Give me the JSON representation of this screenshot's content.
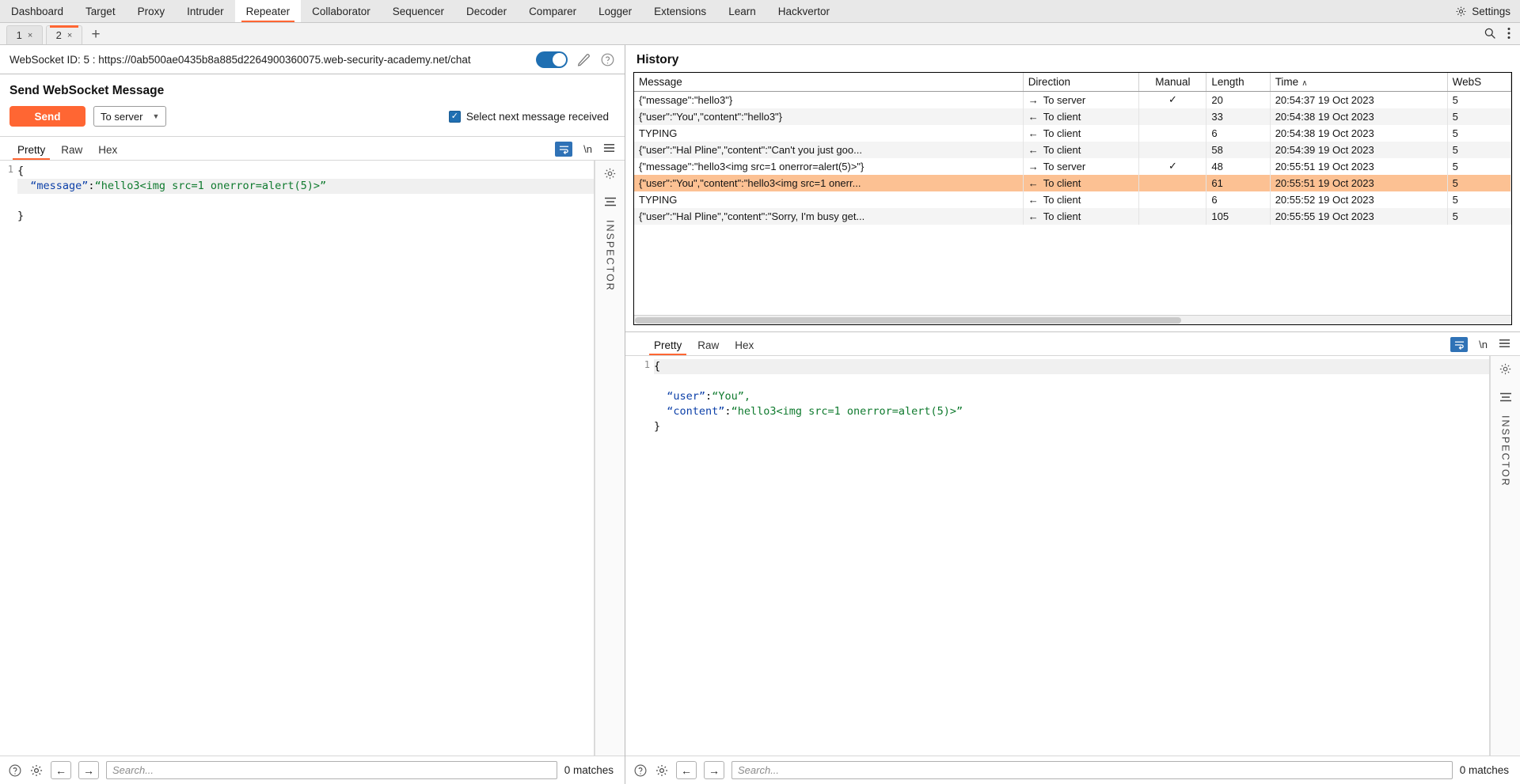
{
  "topbar": {
    "tabs": [
      {
        "label": "Dashboard",
        "active": false
      },
      {
        "label": "Target",
        "active": false
      },
      {
        "label": "Proxy",
        "active": false
      },
      {
        "label": "Intruder",
        "active": false
      },
      {
        "label": "Repeater",
        "active": true
      },
      {
        "label": "Collaborator",
        "active": false
      },
      {
        "label": "Sequencer",
        "active": false
      },
      {
        "label": "Decoder",
        "active": false
      },
      {
        "label": "Comparer",
        "active": false
      },
      {
        "label": "Logger",
        "active": false
      },
      {
        "label": "Extensions",
        "active": false
      },
      {
        "label": "Learn",
        "active": false
      },
      {
        "label": "Hackvertor",
        "active": false
      }
    ],
    "settings_label": "Settings"
  },
  "repeater_tabs": {
    "tabs": [
      {
        "label": "1",
        "close": "×",
        "active": false
      },
      {
        "label": "2",
        "close": "×",
        "active": true
      }
    ],
    "add_label": "+"
  },
  "websocket": {
    "title": "WebSocket ID: 5 : https://0ab500ae0435b8a885d2264900360075.web-security-academy.net/chat",
    "toggle_on": true
  },
  "send_panel": {
    "heading": "Send WebSocket Message",
    "send_label": "Send",
    "direction_value": "To server",
    "direction_options": [
      "To server",
      "To client"
    ],
    "checkbox_label": "Select next message received",
    "checkbox_checked": true
  },
  "request_editor": {
    "tabs": [
      {
        "label": "Pretty",
        "active": true
      },
      {
        "label": "Raw",
        "active": false
      },
      {
        "label": "Hex",
        "active": false
      }
    ],
    "newline_label": "\\n",
    "line_number": "1",
    "line1": "{",
    "line2_key": "“message”",
    "line2_colon": ":",
    "line2_val": "“hello3<img src=1 onerror=alert(5)>”",
    "line3": "}",
    "inspector_label": "INSPECTOR"
  },
  "request_search": {
    "placeholder": "Search...",
    "matches": "0 matches",
    "prev": "←",
    "next": "→"
  },
  "history": {
    "title": "History",
    "columns": [
      "Message",
      "Direction",
      "Manual",
      "Length",
      "Time",
      "WebS"
    ],
    "sort_column": "Time",
    "sort_dir": "∧",
    "rows": [
      {
        "message": "{\"message\":\"hello3\"}",
        "direction": "To server",
        "arrow": "→",
        "manual": "✓",
        "length": "20",
        "time": "20:54:37 19 Oct 2023",
        "webs": "5",
        "selected": false
      },
      {
        "message": "{\"user\":\"You\",\"content\":\"hello3\"}",
        "direction": "To client",
        "arrow": "←",
        "manual": "",
        "length": "33",
        "time": "20:54:38 19 Oct 2023",
        "webs": "5",
        "selected": false
      },
      {
        "message": "TYPING",
        "direction": "To client",
        "arrow": "←",
        "manual": "",
        "length": "6",
        "time": "20:54:38 19 Oct 2023",
        "webs": "5",
        "selected": false
      },
      {
        "message": "{\"user\":\"Hal Pline\",\"content\":\"Can't you just goo...",
        "direction": "To client",
        "arrow": "←",
        "manual": "",
        "length": "58",
        "time": "20:54:39 19 Oct 2023",
        "webs": "5",
        "selected": false
      },
      {
        "message": "{\"message\":\"hello3<img src=1 onerror=alert(5)>\"}",
        "direction": "To server",
        "arrow": "→",
        "manual": "✓",
        "length": "48",
        "time": "20:55:51 19 Oct 2023",
        "webs": "5",
        "selected": false
      },
      {
        "message": "{\"user\":\"You\",\"content\":\"hello3<img src=1 onerr...",
        "direction": "To client",
        "arrow": "←",
        "manual": "",
        "length": "61",
        "time": "20:55:51 19 Oct 2023",
        "webs": "5",
        "selected": true
      },
      {
        "message": "TYPING",
        "direction": "To client",
        "arrow": "←",
        "manual": "",
        "length": "6",
        "time": "20:55:52 19 Oct 2023",
        "webs": "5",
        "selected": false
      },
      {
        "message": "{\"user\":\"Hal Pline\",\"content\":\"Sorry, I'm busy get...",
        "direction": "To client",
        "arrow": "←",
        "manual": "",
        "length": "105",
        "time": "20:55:55 19 Oct 2023",
        "webs": "5",
        "selected": false
      }
    ]
  },
  "response_editor": {
    "tabs": [
      {
        "label": "Pretty",
        "active": true
      },
      {
        "label": "Raw",
        "active": false
      },
      {
        "label": "Hex",
        "active": false
      }
    ],
    "newline_label": "\\n",
    "line_number": "1",
    "line1": "{",
    "line2_key": "“user”",
    "line2_colon": ":",
    "line2_val": "“You”,",
    "line3_key": "“content”",
    "line3_colon": ":",
    "line3_val": "“hello3<img src=1 onerror=alert(5)>”",
    "line4": "}",
    "inspector_label": "INSPECTOR"
  },
  "response_search": {
    "placeholder": "Search...",
    "matches": "0 matches",
    "prev": "←",
    "next": "→"
  },
  "colors": {
    "accent": "#ff6633",
    "selection": "#fcc193",
    "toggle_on": "#1f6fb2",
    "json_key": "#0b3fa8",
    "json_value": "#0f7a2e"
  }
}
